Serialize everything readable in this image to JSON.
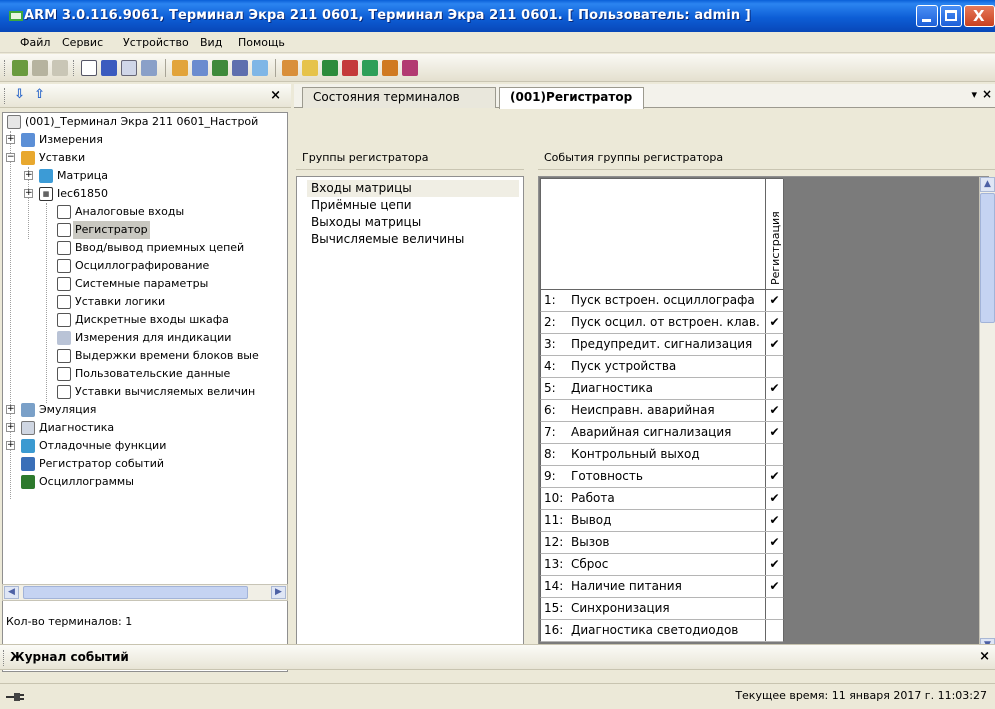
{
  "window": {
    "title": "ARM 3.0.116.9061, Терминал Экра 211 0601, Терминал Экра 211 0601. [ Пользователь: admin ]"
  },
  "menu": [
    "Файл",
    "Сервис",
    "Устройство",
    "Вид",
    "Помощь"
  ],
  "tree": {
    "root": "(001)_Терминал Экра 211 0601_Настрой",
    "items": [
      {
        "label": "Измерения",
        "icon": "measurements-icon"
      },
      {
        "label": "Уставки",
        "icon": "folder-icon"
      },
      {
        "label": "Матрица",
        "icon": "matrix-icon"
      },
      {
        "label": "Iec61850",
        "icon": "iec-icon"
      },
      {
        "label": "Аналоговые входы",
        "icon": "table-icon"
      },
      {
        "label": "Регистратор",
        "icon": "table-icon"
      },
      {
        "label": "Ввод/вывод приемных цепей",
        "icon": "table-icon"
      },
      {
        "label": "Осциллографирование",
        "icon": "table-icon"
      },
      {
        "label": "Системные параметры",
        "icon": "table-icon"
      },
      {
        "label": "Уставки логики",
        "icon": "table-icon"
      },
      {
        "label": "Дискретные входы шкафа",
        "icon": "table-icon"
      },
      {
        "label": "Измерения для индикации",
        "icon": "gauge-icon"
      },
      {
        "label": "Выдержки времени блоков вые",
        "icon": "table-icon"
      },
      {
        "label": "Пользовательские данные",
        "icon": "table-icon"
      },
      {
        "label": "Уставки вычисляемых величин",
        "icon": "table-icon"
      },
      {
        "label": "Эмуляция",
        "icon": "emulation-icon"
      },
      {
        "label": "Диагностика",
        "icon": "diagnostics-icon"
      },
      {
        "label": "Отладочные функции",
        "icon": "debug-icon"
      },
      {
        "label": "Регистратор событий",
        "icon": "event-log-icon"
      },
      {
        "label": "Осциллограммы",
        "icon": "oscillogram-icon"
      }
    ]
  },
  "left_status": "Кол-во терминалов: 1",
  "tabs": [
    "Состояния терминалов",
    "(001)Регистратор"
  ],
  "groups_header": "Группы регистратора",
  "groups": [
    "Входы матрицы",
    "Приёмные цепи",
    "Выходы матрицы",
    "Вычисляемые величины"
  ],
  "events_header": "События группы регистратора",
  "events_column": "Регистрация",
  "events": [
    {
      "num": "1:",
      "name": "Пуск встроен. осциллографа",
      "check": "✔"
    },
    {
      "num": "2:",
      "name": "Пуск осцил. от встроен. клав.",
      "check": "✔"
    },
    {
      "num": "3:",
      "name": "Предупредит. сигнализация",
      "check": "✔"
    },
    {
      "num": "4:",
      "name": "Пуск устройства",
      "check": ""
    },
    {
      "num": "5:",
      "name": "Диагностика",
      "check": "✔"
    },
    {
      "num": "6:",
      "name": "Неисправн. аварийная",
      "check": "✔"
    },
    {
      "num": "7:",
      "name": "Аварийная сигнализация",
      "check": "✔"
    },
    {
      "num": "8:",
      "name": "Контрольный выход",
      "check": ""
    },
    {
      "num": "9:",
      "name": "Готовность",
      "check": "✔"
    },
    {
      "num": "10:",
      "name": "Работа",
      "check": "✔"
    },
    {
      "num": "11:",
      "name": "Вывод",
      "check": "✔"
    },
    {
      "num": "12:",
      "name": "Вызов",
      "check": "✔"
    },
    {
      "num": "13:",
      "name": "Сброс",
      "check": "✔"
    },
    {
      "num": "14:",
      "name": "Наличие питания",
      "check": "✔"
    },
    {
      "num": "15:",
      "name": "Синхронизация",
      "check": ""
    },
    {
      "num": "16:",
      "name": "Диагностика светодиодов",
      "check": ""
    }
  ],
  "bottom_panel": "Журнал событий",
  "status_time": "Текущее время: 11 января 2017 г. 11:03:27"
}
